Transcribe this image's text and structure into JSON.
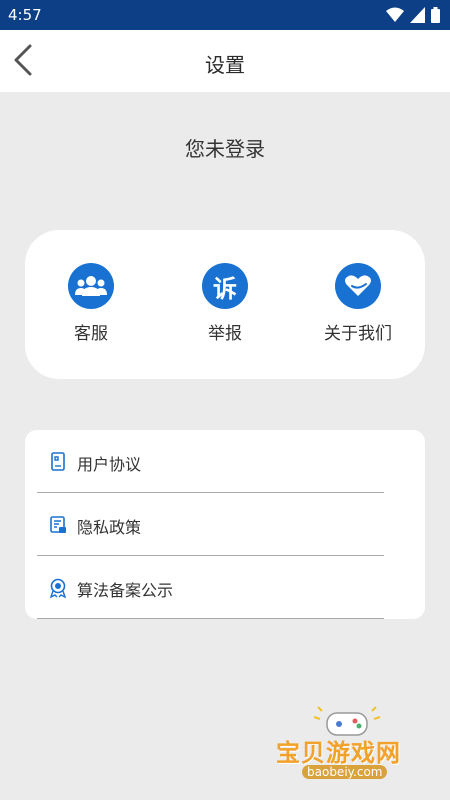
{
  "status_bar": {
    "time": "4:57"
  },
  "header": {
    "title": "设置"
  },
  "login_status": "您未登录",
  "quick_actions": [
    {
      "label": "客服",
      "icon": "customer-service-icon"
    },
    {
      "label": "举报",
      "icon": "report-icon",
      "glyph": "诉"
    },
    {
      "label": "关于我们",
      "icon": "about-heart-icon"
    }
  ],
  "menu": [
    {
      "label": "用户协议",
      "icon": "document-icon"
    },
    {
      "label": "隐私政策",
      "icon": "privacy-icon"
    },
    {
      "label": "算法备案公示",
      "icon": "badge-icon"
    }
  ],
  "watermark": {
    "title": "宝贝游戏网",
    "domain": "baobeiy.com"
  },
  "colors": {
    "status_bar": "#0d3f86",
    "accent": "#1972d2",
    "background": "#ebebeb"
  }
}
